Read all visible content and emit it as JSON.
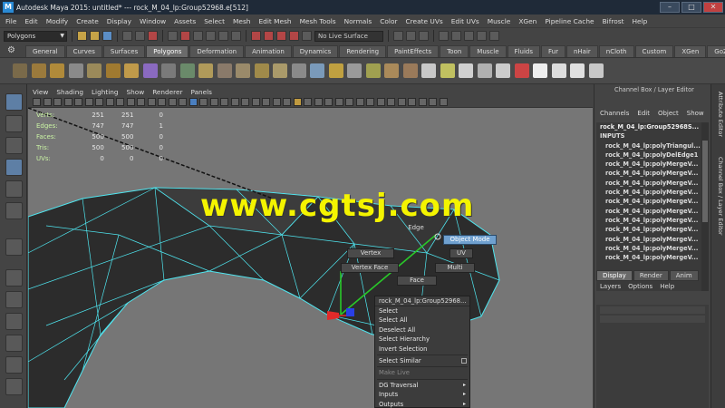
{
  "window": {
    "app_icon": "M",
    "title": "Autodesk Maya 2015: untitled*   ---   rock_M_04_lp:Group52968.e[512]",
    "controls": [
      "–",
      "□",
      "✕"
    ]
  },
  "menubar": [
    "File",
    "Edit",
    "Modify",
    "Create",
    "Display",
    "Window",
    "Assets",
    "Select",
    "Mesh",
    "Edit Mesh",
    "Mesh Tools",
    "Normals",
    "Color",
    "Create UVs",
    "Edit UVs",
    "Muscle",
    "XGen",
    "Pipeline Cache",
    "Bifrost",
    "Help"
  ],
  "status_line": {
    "mode": "Polygons",
    "live_surface": "No Live Surface"
  },
  "shelf": {
    "tabs": [
      "General",
      "Curves",
      "Surfaces",
      "Polygons",
      "Deformation",
      "Animation",
      "Dynamics",
      "Rendering",
      "PaintEffects",
      "Toon",
      "Muscle",
      "Fluids",
      "Fur",
      "nHair",
      "nCloth",
      "Custom",
      "XGen",
      "GoZBrush"
    ],
    "active": "Polygons"
  },
  "viewport": {
    "menu": [
      "View",
      "Shading",
      "Lighting",
      "Show",
      "Renderer",
      "Panels"
    ],
    "hud": [
      {
        "label": "Verts:",
        "a": "251",
        "b": "251",
        "c": "0"
      },
      {
        "label": "Edges:",
        "a": "747",
        "b": "747",
        "c": "1"
      },
      {
        "label": "Faces:",
        "a": "500",
        "b": "500",
        "c": "0"
      },
      {
        "label": "Tris:",
        "a": "500",
        "b": "500",
        "c": "0"
      },
      {
        "label": "UVs:",
        "a": "0",
        "b": "0",
        "c": "0"
      }
    ],
    "marking_menu": {
      "object_mode": "Object Mode",
      "edge": "Edge",
      "vertex": "Vertex",
      "uv": "UV",
      "vertex_face": "Vertex Face",
      "multi": "Multi",
      "face": "Face"
    }
  },
  "context_menu": {
    "header": "rock_M_04_lp:Group52968...",
    "items": [
      "Select",
      "Select All",
      "Deselect All",
      "Select Hierarchy",
      "Invert Selection"
    ],
    "select_similar": "Select Similar",
    "make_live": "Make Live",
    "submenus": [
      "DG Traversal",
      "Inputs",
      "Outputs"
    ],
    "submenu_glyph": "▸"
  },
  "watermark": "www.cgtsj.com",
  "channel_box": {
    "title": "Channel Box / Layer Editor",
    "menu": [
      "Channels",
      "Edit",
      "Object",
      "Show"
    ],
    "object": "rock_M_04_lp:Group52968S...",
    "inputs_label": "INPUTS",
    "inputs": [
      "rock_M_04_lp:polyTriangul...",
      "rock_M_04_lp:polyDelEdge1",
      "rock_M_04_lp:polyMergeV...",
      "rock_M_04_lp:polyMergeV...",
      "rock_M_04_lp:polyMergeV...",
      "rock_M_04_lp:polyMergeV...",
      "rock_M_04_lp:polyMergeV...",
      "rock_M_04_lp:polyMergeV...",
      "rock_M_04_lp:polyMergeV...",
      "rock_M_04_lp:polyMergeV...",
      "rock_M_04_lp:polyMergeV...",
      "rock_M_04_lp:polyMergeV...",
      "rock_M_04_lp:polyMergeV..."
    ]
  },
  "layer_editor": {
    "tabs": [
      "Display",
      "Render",
      "Anim"
    ],
    "active": "Display",
    "menu": [
      "Layers",
      "Options",
      "Help"
    ]
  },
  "side_tabs": [
    "Attribute Editor",
    "Channel Box / Layer Editor"
  ],
  "colors": {
    "wireframe": "#4fe6f0",
    "selection": "#6fa0cf",
    "watermark": "#f4f400",
    "hud_label": "#caf4a4"
  }
}
